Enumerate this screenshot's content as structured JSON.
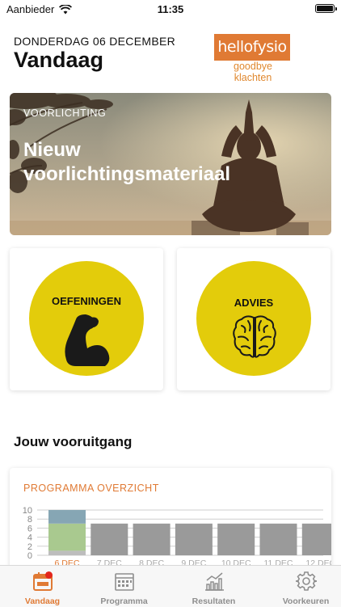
{
  "status_bar": {
    "carrier": "Aanbieder",
    "time": "11:35"
  },
  "header": {
    "date": "DONDERDAG 06 DECEMBER",
    "title": "Vandaag",
    "logo_text": "hellofysio",
    "logo_tagline": "goodbye klachten"
  },
  "hero": {
    "kicker": "VOORLICHTING",
    "headline": "Nieuw voorlichtingsmateriaal"
  },
  "tiles": [
    {
      "label": "OEFENINGEN",
      "icon": "flexed-arm-icon"
    },
    {
      "label": "ADVIES",
      "icon": "brain-icon"
    }
  ],
  "progress": {
    "section_title": "Jouw vooruitgang",
    "card_title": "PROGRAMMA OVERZICHT"
  },
  "chart_data": {
    "type": "bar",
    "title": "PROGRAMMA OVERZICHT",
    "categories": [
      "6 DEC",
      "7 DEC",
      "8 DEC",
      "9 DEC",
      "10 DEC",
      "11 DEC",
      "12 DEC"
    ],
    "series": [
      {
        "values": [
          1,
          0,
          0,
          0,
          0,
          0,
          0
        ],
        "color": "#bdbdbd"
      },
      {
        "values": [
          6,
          0,
          0,
          0,
          0,
          0,
          0
        ],
        "color": "#a9c98f"
      },
      {
        "values": [
          3,
          7,
          7,
          7,
          7,
          7,
          7
        ],
        "color": "#9a9a9a"
      }
    ],
    "series_colors_today": [
      "#bdbdbd",
      "#a9c98f",
      "#86a6b4"
    ],
    "yticks": [
      0,
      2,
      4,
      6,
      8,
      10
    ],
    "ylim": [
      0,
      10
    ],
    "highlight_category": "6 DEC",
    "highlight_color": "#e07a34",
    "grid": true
  },
  "tabbar": {
    "items": [
      {
        "label": "Vandaag",
        "icon": "calendar-icon",
        "active": true
      },
      {
        "label": "Programma",
        "icon": "schedule-icon",
        "active": false
      },
      {
        "label": "Resultaten",
        "icon": "chart-icon",
        "active": false
      },
      {
        "label": "Voorkeuren",
        "icon": "gear-icon",
        "active": false
      }
    ]
  },
  "colors": {
    "accent": "#e07a34",
    "tile_circle": "#e3cc0b",
    "badge": "#e3261c"
  }
}
